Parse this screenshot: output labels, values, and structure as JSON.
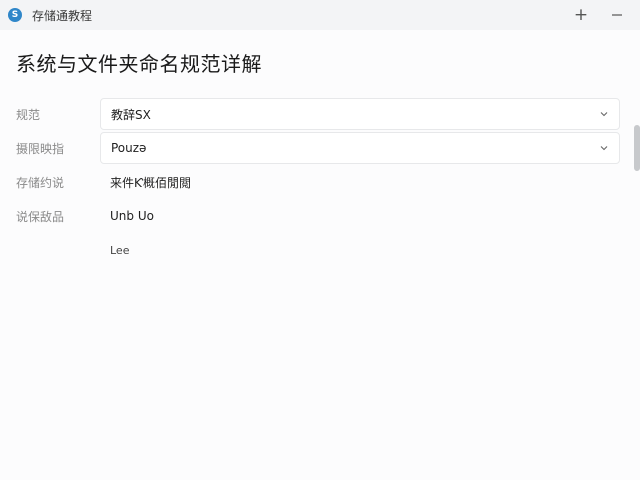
{
  "window": {
    "title": "存储通教程",
    "app_icon": "S",
    "accent": "#2f86c9"
  },
  "page": {
    "title": "系统与文件夹命名规范详解"
  },
  "form": {
    "rows": [
      {
        "label": "规范",
        "value": "教辞SX"
      },
      {
        "label": "摄限映指",
        "value": "Pouzə"
      },
      {
        "label": "存储约说",
        "value": "来件Ƙ概佰閒閲"
      },
      {
        "label": "说保敌品",
        "value": "Unb Uo"
      }
    ],
    "extra_value": "Lee"
  }
}
